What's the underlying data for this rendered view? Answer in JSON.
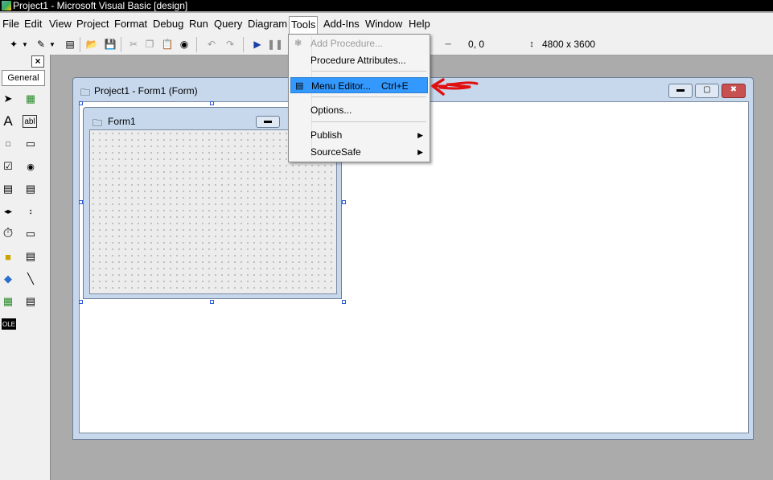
{
  "window": {
    "title": "Project1 - Microsoft Visual Basic [design]"
  },
  "menubar": {
    "items": [
      "File",
      "Edit",
      "View",
      "Project",
      "Format",
      "Debug",
      "Run",
      "Query",
      "Diagram",
      "Tools",
      "Add-Ins",
      "Window",
      "Help"
    ],
    "open_menu": "Tools"
  },
  "toolbar": {
    "position_readout": "0, 0",
    "size_readout": "4800 x 3600"
  },
  "toolbox": {
    "close_label": "×",
    "tab_label": "General"
  },
  "form_designer": {
    "title": "Project1 - Form1 (Form)",
    "inner_form_title": "Form1"
  },
  "tools_menu": {
    "items": [
      {
        "label": "Add Procedure...",
        "state": "disabled"
      },
      {
        "label": "Procedure Attributes..."
      },
      {
        "label": "Menu Editor...",
        "shortcut": "Ctrl+E",
        "state": "highlighted"
      },
      {
        "label": "Options..."
      },
      {
        "label": "Publish",
        "submenu": true
      },
      {
        "label": "SourceSafe",
        "submenu": true
      }
    ]
  },
  "colors": {
    "highlight": "#3399ff",
    "annotation_arrow": "#e01010",
    "mdi_background": "#ababab",
    "form_frame": "#c7d8ec"
  },
  "icons": [
    "add-procedure-icon",
    "menu-editor-icon",
    "red-arrow-annotation"
  ]
}
